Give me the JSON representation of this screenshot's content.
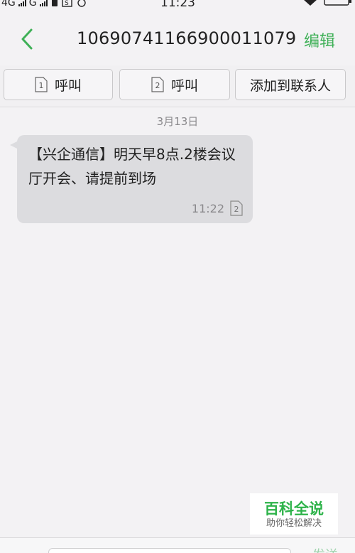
{
  "status_bar": {
    "net1": "4G",
    "net2": "G",
    "time": "11:23"
  },
  "header": {
    "title": "10690741166900011079",
    "edit_label": "编辑"
  },
  "actions": {
    "call_sim1_label": "呼叫",
    "sim1_number": "1",
    "call_sim2_label": "呼叫",
    "sim2_number": "2",
    "add_contact_label": "添加到联系人"
  },
  "conversation": {
    "date": "3月13日",
    "messages": [
      {
        "text": "【兴企通信】明天早8点.2楼会议厅开会、请提前到场",
        "time": "11:22",
        "sim": "2"
      }
    ]
  },
  "watermark": {
    "main": "百科全说",
    "sub": "助你轻松解决"
  },
  "input_bar": {
    "send_label": "发送"
  },
  "colors": {
    "accent": "#3fb057",
    "background": "#f3f2f4",
    "bubble": "#dcdcdf"
  }
}
